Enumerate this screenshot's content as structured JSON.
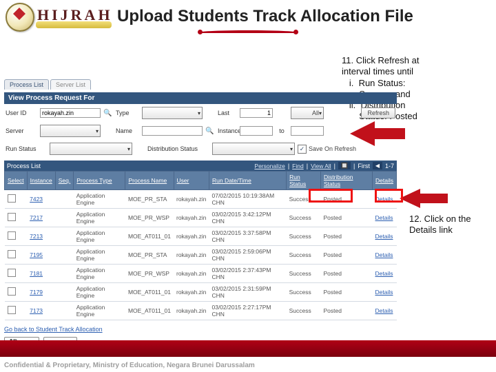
{
  "brand": {
    "word": "HIJRAH"
  },
  "title": "Upload Students Track Allocation File",
  "tabs": [
    "Process List",
    "Server List"
  ],
  "section": {
    "viewHeader": "View Process Request For",
    "listHeader": "Process List"
  },
  "filters": {
    "userId": {
      "label": "User ID",
      "value": "rokayah.zin"
    },
    "type": {
      "label": "Type"
    },
    "last": {
      "label": "Last",
      "value": "1",
      "unit": "All"
    },
    "server": {
      "label": "Server"
    },
    "name": {
      "label": "Name"
    },
    "instance": {
      "label": "Instance",
      "to": "to"
    },
    "runStatus": {
      "label": "Run Status"
    },
    "distStatus": {
      "label": "Distribution Status"
    },
    "saveOnRefresh": "Save On Refresh"
  },
  "buttons": {
    "refresh": "Refresh",
    "save": "Save",
    "notify": "Notify"
  },
  "listbar": {
    "personalize": "Personalize",
    "find": "Find",
    "viewAll": "View All",
    "first": "First",
    "range": "1-7"
  },
  "cols": [
    "Select",
    "Instance",
    "Seq.",
    "Process Type",
    "Process Name",
    "User",
    "Run Date/Time",
    "Run Status",
    "Distribution Status",
    "Details"
  ],
  "rows": [
    {
      "inst": "7423",
      "seq": "",
      "ptype": "Application Engine",
      "pname": "MOE_PR_STA",
      "user": "rokayah.zin",
      "dt": "07/02/2015 10:19:38AM CHN",
      "run": "Success",
      "dist": "Posted",
      "det": "Details"
    },
    {
      "inst": "7217",
      "seq": "",
      "ptype": "Application Engine",
      "pname": "MOE_PR_WSP",
      "user": "rokayah.zin",
      "dt": "03/02/2015 3:42:12PM CHN",
      "run": "Success",
      "dist": "Posted",
      "det": "Details"
    },
    {
      "inst": "7213",
      "seq": "",
      "ptype": "Application Engine",
      "pname": "MOE_AT011_01",
      "user": "rokayah.zin",
      "dt": "03/02/2015 3:37:58PM CHN",
      "run": "Success",
      "dist": "Posted",
      "det": "Details"
    },
    {
      "inst": "7195",
      "seq": "",
      "ptype": "Application Engine",
      "pname": "MOE_PR_STA",
      "user": "rokayah.zin",
      "dt": "03/02/2015 2:59:06PM CHN",
      "run": "Success",
      "dist": "Posted",
      "det": "Details"
    },
    {
      "inst": "7181",
      "seq": "",
      "ptype": "Application Engine",
      "pname": "MOE_PR_WSP",
      "user": "rokayah.zin",
      "dt": "03/02/2015 2:37:43PM CHN",
      "run": "Success",
      "dist": "Posted",
      "det": "Details"
    },
    {
      "inst": "7179",
      "seq": "",
      "ptype": "Application Engine",
      "pname": "MOE_AT011_01",
      "user": "rokayah.zin",
      "dt": "03/02/2015 2:31:59PM CHN",
      "run": "Success",
      "dist": "Posted",
      "det": "Details"
    },
    {
      "inst": "7173",
      "seq": "",
      "ptype": "Application Engine",
      "pname": "MOE_AT011_01",
      "user": "rokayah.zin",
      "dt": "03/02/2015 2:27:17PM CHN",
      "run": "Success",
      "dist": "Posted",
      "det": "Details"
    }
  ],
  "links": {
    "goBack": "Go back to Student Track Allocation"
  },
  "callouts": {
    "c11": {
      "head": "11. Click Refresh at",
      "line2": "interval times until",
      "i_a": "Run Status:",
      "i_b": "Success and",
      "ii_a": "Distribution",
      "ii_b": "Status: Posted"
    },
    "c12": {
      "l1": "12. Click on the",
      "l2": "Details link"
    }
  },
  "footer": "Confidential & Proprietary, Ministry of Education, Negara Brunei Darussalam"
}
